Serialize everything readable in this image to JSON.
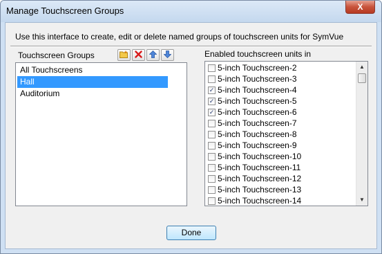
{
  "window": {
    "title": "Manage Touchscreen Groups",
    "close_label": "X"
  },
  "description": "Use this interface to create, edit or delete named groups of touchscreen units for SymVue",
  "groups_panel": {
    "label": "Touchscreen Groups",
    "toolbar_icons": [
      "add-folder-icon",
      "delete-icon",
      "move-up-icon",
      "move-down-icon"
    ],
    "items": [
      {
        "label": "All Touchscreens",
        "selected": false
      },
      {
        "label": "Hall",
        "selected": true
      },
      {
        "label": "Auditorium",
        "selected": false
      }
    ]
  },
  "units_panel": {
    "label": "Enabled touchscreen units in",
    "units": [
      {
        "label": "5-inch Touchscreen-2",
        "checked": false
      },
      {
        "label": "5-inch Touchscreen-3",
        "checked": false
      },
      {
        "label": "5-inch Touchscreen-4",
        "checked": true
      },
      {
        "label": "5-inch Touchscreen-5",
        "checked": true
      },
      {
        "label": "5-inch Touchscreen-6",
        "checked": true
      },
      {
        "label": "5-inch Touchscreen-7",
        "checked": false
      },
      {
        "label": "5-inch Touchscreen-8",
        "checked": false
      },
      {
        "label": "5-inch Touchscreen-9",
        "checked": false
      },
      {
        "label": "5-inch Touchscreen-10",
        "checked": false
      },
      {
        "label": "5-inch Touchscreen-11",
        "checked": false
      },
      {
        "label": "5-inch Touchscreen-12",
        "checked": false
      },
      {
        "label": "5-inch Touchscreen-13",
        "checked": false
      },
      {
        "label": "5-inch Touchscreen-14",
        "checked": false
      }
    ]
  },
  "done_label": "Done",
  "colors": {
    "selection": "#3399ff",
    "close_button": "#c8533b",
    "title_bar": "#cfe0f3"
  }
}
